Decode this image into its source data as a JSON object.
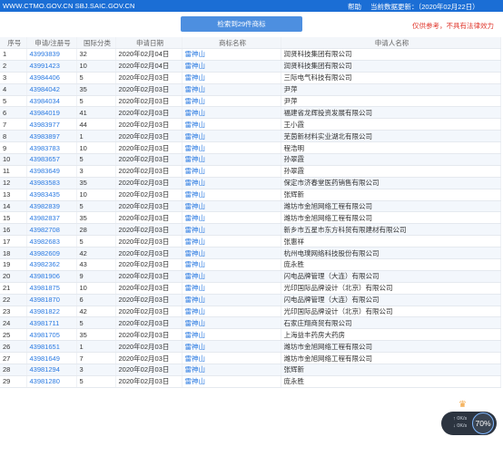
{
  "topbar": {
    "site": "WWW.CTMO.GOV.CN SBJ.SAIC.GOV.CN",
    "help": "帮助",
    "current_data": "当前数据更新：（2020年02月22日）"
  },
  "summary": "检索到29件商标",
  "note": "仅供参考，不具有法律效力",
  "columns": [
    "序号",
    "申请/注册号",
    "国际分类",
    "申请日期",
    "商标名称",
    "申请人名称"
  ],
  "rows": [
    [
      "1",
      "43993839",
      "32",
      "2020年02月04日",
      "雷神山",
      "润贤科技集团有限公司"
    ],
    [
      "2",
      "43991423",
      "10",
      "2020年02月04日",
      "雷神山",
      "润贤科技集团有限公司"
    ],
    [
      "3",
      "43984406",
      "5",
      "2020年02月03日",
      "雷神山",
      "三际电气科技有限公司"
    ],
    [
      "4",
      "43984042",
      "35",
      "2020年02月03日",
      "雷神山",
      "尹萍"
    ],
    [
      "5",
      "43984034",
      "5",
      "2020年02月03日",
      "雷神山",
      "尹萍"
    ],
    [
      "6",
      "43984019",
      "41",
      "2020年02月03日",
      "雷神山",
      "福建省龙辉投资发展有限公司"
    ],
    [
      "7",
      "43983977",
      "44",
      "2020年02月03日",
      "雷神山",
      "王小霞"
    ],
    [
      "8",
      "43983897",
      "1",
      "2020年02月03日",
      "雷神山",
      "芜茵新材料实业湖北有限公司"
    ],
    [
      "9",
      "43983783",
      "10",
      "2020年02月03日",
      "雷神山",
      "程浩明"
    ],
    [
      "10",
      "43983657",
      "5",
      "2020年02月03日",
      "雷神山",
      "孙翠霞"
    ],
    [
      "11",
      "43983649",
      "3",
      "2020年02月03日",
      "雷神山",
      "孙翠霞"
    ],
    [
      "12",
      "43983583",
      "35",
      "2020年02月03日",
      "雷神山",
      "保定市济春堂医药销售有限公司"
    ],
    [
      "13",
      "43983435",
      "10",
      "2020年02月03日",
      "雷神山",
      "张辉新"
    ],
    [
      "14",
      "43982839",
      "5",
      "2020年02月03日",
      "雷神山",
      "潍坊市金旭网络工程有限公司"
    ],
    [
      "15",
      "43982837",
      "35",
      "2020年02月03日",
      "雷神山",
      "潍坊市金旭网络工程有限公司"
    ],
    [
      "16",
      "43982708",
      "28",
      "2020年02月03日",
      "雷神山",
      "新乡市五星市东方科贸有限建材有限公司"
    ],
    [
      "17",
      "43982683",
      "5",
      "2020年02月03日",
      "雷神山",
      "张惠祥"
    ],
    [
      "18",
      "43982609",
      "42",
      "2020年02月03日",
      "雷神山",
      "杭州电璞网络科技股份有限公司"
    ],
    [
      "19",
      "43982362",
      "43",
      "2020年02月03日",
      "雷神山",
      "庞永胜"
    ],
    [
      "20",
      "43981906",
      "9",
      "2020年02月03日",
      "雷神山",
      "闪电品牌管理（大连）有限公司"
    ],
    [
      "21",
      "43981875",
      "10",
      "2020年02月03日",
      "雷神山",
      "光印国际品牌设计（北京）有限公司"
    ],
    [
      "22",
      "43981870",
      "6",
      "2020年02月03日",
      "雷神山",
      "闪电品牌管理（大连）有限公司"
    ],
    [
      "23",
      "43981822",
      "42",
      "2020年02月03日",
      "雷神山",
      "光印国际品牌设计（北京）有限公司"
    ],
    [
      "24",
      "43981711",
      "5",
      "2020年02月03日",
      "雷神山",
      "石家庄翔商贸有限公司"
    ],
    [
      "25",
      "43981705",
      "35",
      "2020年02月03日",
      "雷神山",
      "上海益丰药房大药房"
    ],
    [
      "26",
      "43981651",
      "1",
      "2020年02月03日",
      "雷神山",
      "潍坊市金旭网络工程有限公司"
    ],
    [
      "27",
      "43981649",
      "7",
      "2020年02月03日",
      "雷神山",
      "潍坊市金旭网络工程有限公司"
    ],
    [
      "28",
      "43981294",
      "3",
      "2020年02月03日",
      "雷神山",
      "张辉新"
    ],
    [
      "29",
      "43981280",
      "5",
      "2020年02月03日",
      "雷神山",
      "庞永胜"
    ]
  ],
  "widget": {
    "up": "0K/s",
    "down": "0K/s",
    "percent": "70%"
  },
  "icons": {
    "badge": "crown-icon"
  }
}
